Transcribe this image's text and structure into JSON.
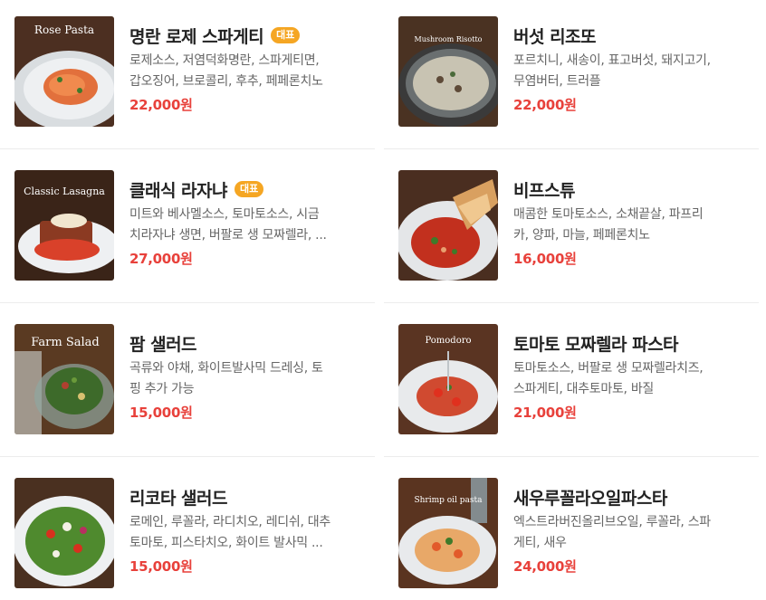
{
  "menu": {
    "items": [
      {
        "name": "명란 로제 스파게티",
        "badge": "대표",
        "desc_line1": "로제소스, 저염덕화명란, 스파게티면,",
        "desc_line2": "갑오징어, 브로콜리, 후추, 페페론치노",
        "price": "22,000원",
        "photo_label": "Rose Pasta",
        "photo": "rose-pasta"
      },
      {
        "name": "버섯 리조또",
        "badge": "",
        "desc_line1": "포르치니, 새송이, 표고버섯, 돼지고기,",
        "desc_line2": "무염버터, 트러플",
        "price": "22,000원",
        "photo_label": "Mushroom Risotto",
        "photo": "risotto"
      },
      {
        "name": "클래식 라자냐",
        "badge": "대표",
        "desc_line1": "미트와 베사멜소스, 토마토소스, 시금",
        "desc_line2": "치라자냐 생면, 버팔로 생 모짜렐라, ...",
        "price": "27,000원",
        "photo_label": "Classic Lasagna",
        "photo": "lasagna"
      },
      {
        "name": "비프스튜",
        "badge": "",
        "desc_line1": "매콤한 토마토소스, 소채끝살, 파프리",
        "desc_line2": "카, 양파, 마늘, 페페론치노",
        "price": "16,000원",
        "photo_label": "",
        "photo": "stew"
      },
      {
        "name": "팜 샐러드",
        "badge": "",
        "desc_line1": "곡류와 야채, 화이트발사믹 드레싱, 토",
        "desc_line2": "핑 추가 가능",
        "price": "15,000원",
        "photo_label": "Farm Salad",
        "photo": "farm-salad"
      },
      {
        "name": "토마토 모짜렐라 파스타",
        "badge": "",
        "desc_line1": "토마토소스, 버팔로 생 모짜렐라치즈,",
        "desc_line2": "스파게티, 대추토마토, 바질",
        "price": "21,000원",
        "photo_label": "Pomodoro",
        "photo": "pomodoro"
      },
      {
        "name": "리코타 샐러드",
        "badge": "",
        "desc_line1": "로메인, 루꼴라, 라디치오, 레디쉬, 대추",
        "desc_line2": "토마토, 피스타치오, 화이트 발사믹 ...",
        "price": "15,000원",
        "photo_label": "",
        "photo": "ricotta-salad"
      },
      {
        "name": "새우루꼴라오일파스타",
        "badge": "",
        "desc_line1": "엑스트라버진올리브오일, 루꼴라, 스파",
        "desc_line2": "게티, 새우",
        "price": "24,000원",
        "photo_label": "Shrimp oil pasta",
        "photo": "shrimp-pasta"
      }
    ]
  },
  "colors": {
    "price": "#e8413b",
    "badge": "#f5a623"
  }
}
